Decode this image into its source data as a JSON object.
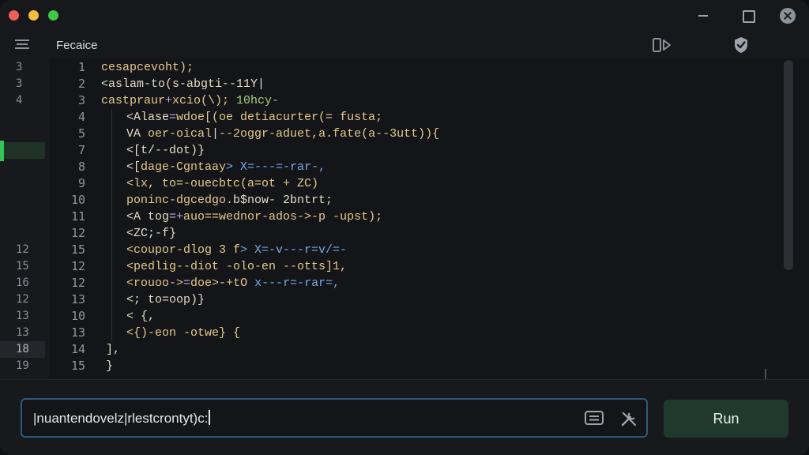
{
  "window": {
    "controls": [
      "close",
      "minimize",
      "zoom"
    ],
    "actions": [
      "minimize-icon",
      "maximize-icon",
      "close-icon"
    ]
  },
  "toolbar": {
    "file_title": "Fecaice",
    "icons": [
      "menu-icon",
      "split-view-icon",
      "checkmark-shield-icon"
    ]
  },
  "gutter": {
    "markers": [
      "3",
      "3",
      "4",
      "",
      "",
      "",
      "",
      "",
      "",
      "",
      "",
      "12",
      "15",
      "16",
      "12",
      "13",
      "13",
      "18",
      "19"
    ]
  },
  "editor": {
    "line_numbers": [
      "1",
      "2",
      "3",
      "4",
      "5",
      "7",
      "8",
      "9",
      "10",
      "11",
      "12",
      "15",
      "12",
      "12",
      "13",
      "10",
      "13",
      "14",
      "15"
    ],
    "lines": [
      {
        "indent": 0,
        "parts": [
          {
            "t": "cesapcevoht);",
            "c": "amber"
          }
        ]
      },
      {
        "indent": 0,
        "parts": [
          {
            "t": "<aslam-to(s-abgti--11Y",
            "c": "cream"
          },
          {
            "t": "|",
            "c": "white"
          }
        ]
      },
      {
        "indent": 0,
        "parts": [
          {
            "t": "castpraur",
            "c": "amber"
          },
          {
            "t": "+",
            "c": "purple"
          },
          {
            "t": "xcio(\\); ",
            "c": "amber"
          },
          {
            "t": "10hcy-",
            "c": "green"
          }
        ]
      },
      {
        "indent": 1,
        "parts": [
          {
            "t": "<Alase",
            "c": "cream"
          },
          {
            "t": "=",
            "c": "purple"
          },
          {
            "t": "wdoe[(oe detiacurter(= fusta;",
            "c": "amber"
          }
        ]
      },
      {
        "indent": 1,
        "parts": [
          {
            "t": "VA ",
            "c": "cream"
          },
          {
            "t": "oer-oical",
            "c": "amber"
          },
          {
            "t": "|",
            "c": "white"
          },
          {
            "t": "--2oggr-aduet,a.fate(a--3utt)){",
            "c": "amber"
          }
        ]
      },
      {
        "indent": 1,
        "parts": [
          {
            "t": "<[t/--dot)}",
            "c": "cream"
          }
        ]
      },
      {
        "indent": 1,
        "parts": [
          {
            "t": "<[",
            "c": "cream"
          },
          {
            "t": "dage-Cgntaay",
            "c": "amber"
          },
          {
            "t": "> X=---=-rar-,",
            "c": "blue"
          }
        ]
      },
      {
        "indent": 1,
        "parts": [
          {
            "t": "<lx, to=-ouecbtc(a=ot + ZC)",
            "c": "amber"
          }
        ]
      },
      {
        "indent": 1,
        "parts": [
          {
            "t": "poninc-dgcedgo.",
            "c": "amber"
          },
          {
            "t": "b$now- 2bntrt;",
            "c": "cream"
          }
        ]
      },
      {
        "indent": 1,
        "parts": [
          {
            "t": "<A tog",
            "c": "cream"
          },
          {
            "t": "=+",
            "c": "purple"
          },
          {
            "t": "auo==wednor-ados->-p -upst);",
            "c": "amber"
          }
        ]
      },
      {
        "indent": 1,
        "parts": [
          {
            "t": "<ZC;-f}",
            "c": "cream"
          }
        ]
      },
      {
        "indent": 1,
        "parts": [
          {
            "t": "<coupor-dlog 3 f",
            "c": "amber"
          },
          {
            "t": "> X=-v---r=v/=-",
            "c": "blue"
          }
        ]
      },
      {
        "indent": 1,
        "parts": [
          {
            "t": "<pedlig--diot -olo-en --otts]1,",
            "c": "amber"
          }
        ]
      },
      {
        "indent": 1,
        "parts": [
          {
            "t": "<rouoo->",
            "c": "amber"
          },
          {
            "t": "=",
            "c": "purple"
          },
          {
            "t": "doe>",
            "c": "amber"
          },
          {
            "t": "-",
            "c": "white"
          },
          {
            "t": "+tO ",
            "c": "amber"
          },
          {
            "t": "x---r=-rar=,",
            "c": "blue"
          }
        ]
      },
      {
        "indent": 1,
        "parts": [
          {
            "t": "<; to=oop)}",
            "c": "cream"
          }
        ]
      },
      {
        "indent": 1,
        "parts": [
          {
            "t": "< {,",
            "c": "cream"
          }
        ]
      },
      {
        "indent": 1,
        "parts": [
          {
            "t": "<{)-eon -otwe} {",
            "c": "amber"
          }
        ]
      },
      {
        "indent": 0,
        "parts": [
          {
            "t": "],",
            "c": "cream"
          }
        ]
      },
      {
        "indent": 0,
        "parts": [
          {
            "t": "}",
            "c": "cream"
          }
        ]
      }
    ]
  },
  "prompt": {
    "value": "|nuantendovelz|rlestcrontyt)c:"
  },
  "run_button": {
    "label": "Run"
  },
  "colors": {
    "accent_green": "#34c45a",
    "run_bg": "#1f3a2c",
    "prompt_border": "#2c5a7a"
  }
}
